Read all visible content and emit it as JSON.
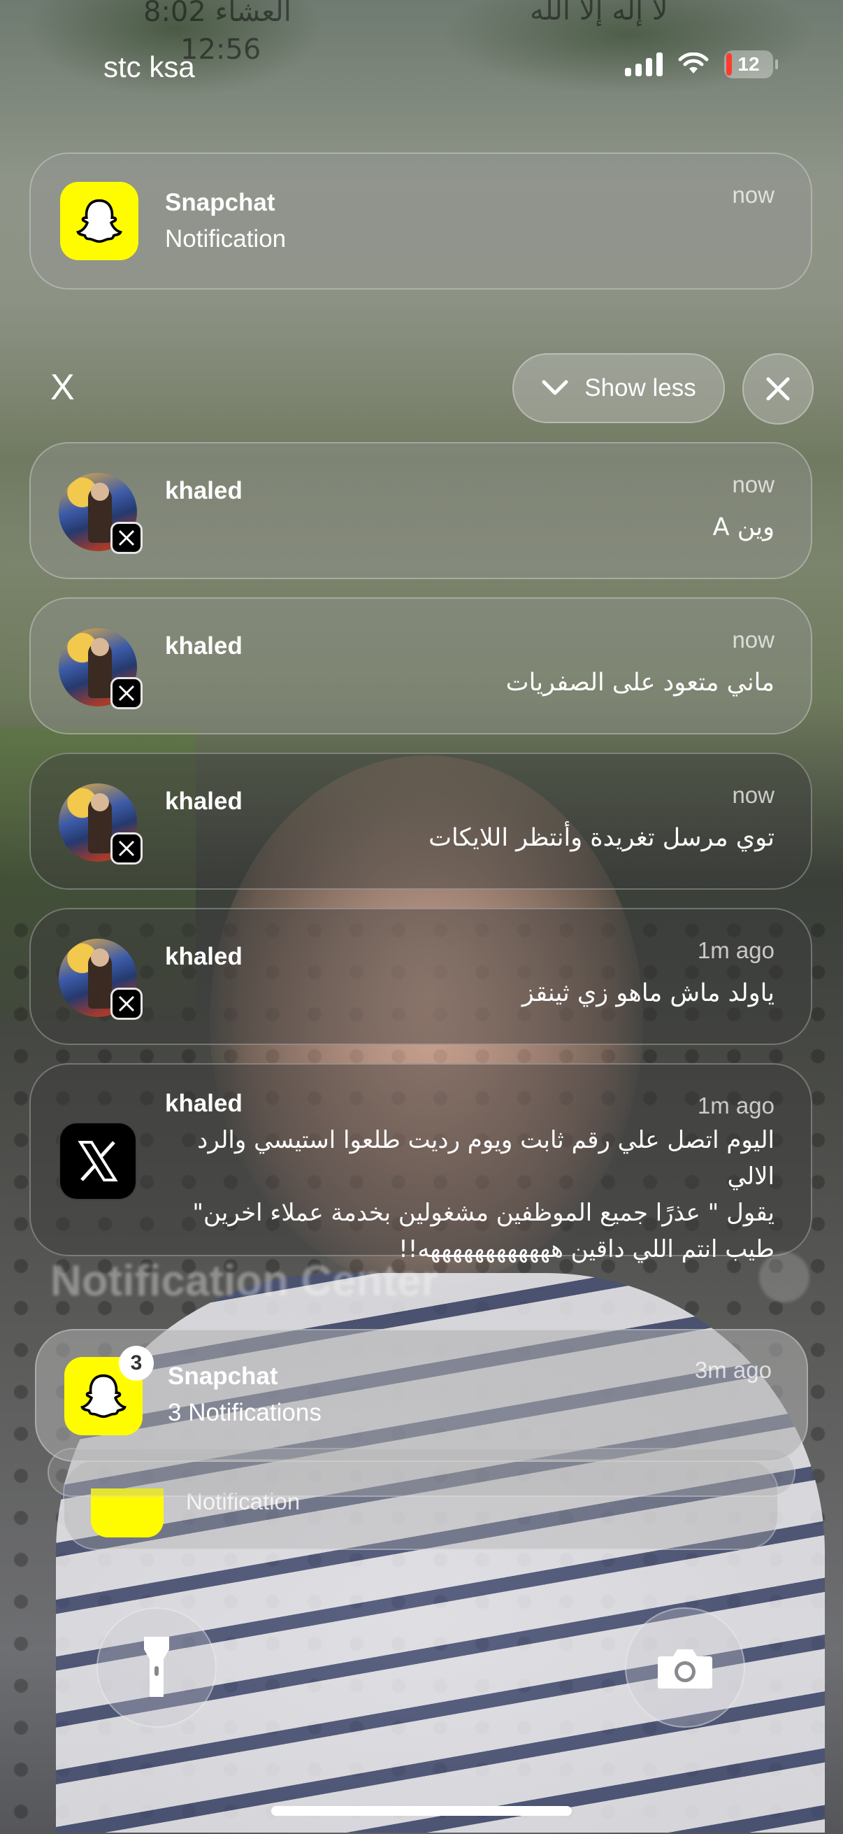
{
  "lockscreen": {
    "faded_time_arabic": "العشاء 8:02",
    "faded_phrase_arabic": "لا إله إلا الله",
    "faded_clock": "12:56"
  },
  "status_bar": {
    "carrier": "stc ksa",
    "battery_level": "12",
    "signal_icon": "signal-bars-icon",
    "wifi_icon": "wifi-icon"
  },
  "top_notification": {
    "app": "Snapchat",
    "text": "Notification",
    "time": "now"
  },
  "group_controls": {
    "dismiss_label": "X",
    "show_less_label": "Show less",
    "close_icon": "close-icon"
  },
  "notifications": [
    {
      "title": "khaled",
      "time": "now",
      "message": "وين A"
    },
    {
      "title": "khaled",
      "time": "now",
      "message": "ماني متعود على الصفريات"
    },
    {
      "title": "khaled",
      "time": "now",
      "message": "توي مرسل تغريدة وأنتظر اللايكات"
    },
    {
      "title": "khaled",
      "time": "1m ago",
      "message": "ياولد ماش ماهو زي ثينقز"
    },
    {
      "title": "khaled",
      "time": "1m ago",
      "message_lines": [
        "اليوم اتصل علي رقم ثابت ويوم رديت طلعوا استيسي  والرد الالي",
        "يقول \" عذرًا جميع الموظفين مشغولين بخدمة عملاء اخرين\"",
        "طيب انتم اللي داقين ههههههههههههه!!"
      ]
    }
  ],
  "notification_center": {
    "header": "Notification Center"
  },
  "snapchat_stack": {
    "app": "Snapchat",
    "text": "3 Notifications",
    "time": "3m ago",
    "badge": "3",
    "behind_text": "Notification"
  },
  "quick_actions": {
    "flashlight_icon": "flashlight-icon",
    "camera_icon": "camera-icon"
  },
  "colors": {
    "snapchat_yellow": "#FFFC00",
    "battery_low": "#FF3B30"
  }
}
